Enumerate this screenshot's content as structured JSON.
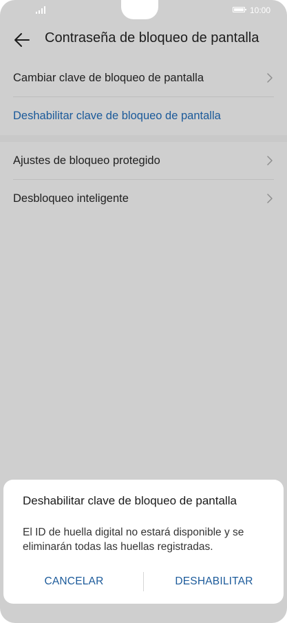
{
  "status_bar": {
    "time": "10:00",
    "signal_icon": "signal-bars-icon",
    "battery_icon": "battery-icon"
  },
  "header": {
    "back_icon": "arrow-left-icon",
    "title": "Contraseña de bloqueo de pantalla"
  },
  "settings": {
    "group1": [
      {
        "label": "Cambiar clave de bloqueo de pantalla",
        "has_chevron": true
      },
      {
        "label": "Deshabilitar clave de bloqueo de pantalla",
        "has_chevron": false
      }
    ],
    "group2": [
      {
        "label": "Ajustes de bloqueo protegido",
        "has_chevron": true
      },
      {
        "label": "Desbloqueo inteligente",
        "has_chevron": true
      }
    ]
  },
  "dialog": {
    "title": "Deshabilitar clave de bloqueo de pantalla",
    "message": "El ID de huella digital no estará disponible y se eliminarán todas las huellas registradas.",
    "cancel_label": "CANCELAR",
    "confirm_label": "DESHABILITAR"
  },
  "colors": {
    "accent": "#1b5a9a",
    "dim_background": "#cfcfcf",
    "dialog_background": "#ffffff"
  }
}
